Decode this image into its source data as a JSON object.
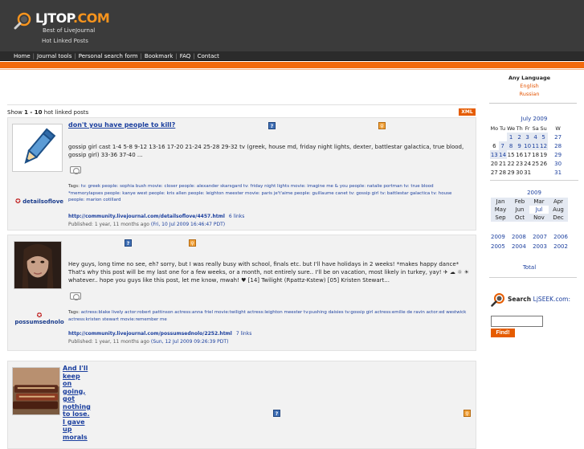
{
  "header": {
    "logo_main": "LJTOP",
    "logo_dot": ".COM",
    "tagline": "Best of LiveJournal",
    "subtitle": "Hot Linked Posts"
  },
  "nav": {
    "items": [
      "Home",
      "Journal tools",
      "Personal search form",
      "Bookmark",
      "FAQ",
      "Contact"
    ]
  },
  "language": {
    "title": "Any Language",
    "options": [
      "English",
      "Russian"
    ]
  },
  "listing": {
    "show_prefix": "Show",
    "range": "1 - 10",
    "suffix": "hot linked posts",
    "xml_label": "XML"
  },
  "posts": [
    {
      "user": "detailsoflove",
      "title": "don't you have people to kill?",
      "text": "gossip girl cast 1-4   5-8 9-12 13-16 17-20 21-24 25-28 29-32 tv (greek, house md, friday night lights, dexter, battlestar galactica, true blood, gossip girl) 33-36 37-40 ...",
      "tags_prefix": "Tags:",
      "tags": "tv: greek people: sophia bush movie: closer people: alexander skarsgard tv: friday night lights movie: imagine me & you people: natalie portman tv: true blood *memorylapses people: kanye west people: kris allen people: leighton meester movie: paris je't'aime people: guillaume canet tv: gossip girl tv: battlestar galactica tv: house people: marion cotillard",
      "link": "http://community.livejournal.com/detailsoflove/4457.html",
      "links_count": "6 links",
      "published_prefix": "Published: 1 year, 11 months ago",
      "published_date": "(Fri, 10 Jul 2009 16:46:47 PDT)"
    },
    {
      "user": "possumsednolo",
      "title": "",
      "text": "Hey guys, long time no see, eh? sorry, but I was really busy with school, finals etc. but I'll have holidays in 2 weeks! *makes happy dance* That's why this post will be my last one for a few weeks, or a month, not entirely sure.. I'll be on vacation, most likely in turkey, yay! ✈ ☁ ☼ ☀ whatever.. hope you guys like this post, let me know, mwah! ♥ [14] Twilight (Rpattz-Kstew) [05] Kristen Stewart...",
      "tags_prefix": "Tags:",
      "tags": "actress:blake lively actor:robert pattinson actress:anna friel movie:twilight actress:leighton meester tv:pushing daisies tv:gossip girl actress:emilie de ravin actor:ed westwick actress:kristen stewart movie:remember me",
      "link": "http://community.livejournal.com/possumsednolo/2252.html",
      "links_count": "7 links",
      "published_prefix": "Published: 1 year, 11 months ago",
      "published_date": "(Sun, 12 Jul 2009 09:26:39 PDT)"
    },
    {
      "user": "",
      "title": "And I'll keep on going, got nothing to lose. I gave up morals"
    }
  ],
  "calendar": {
    "month": "July 2009",
    "headers": [
      "Mo",
      "Tu",
      "We",
      "Th",
      "Fr",
      "Sa",
      "Su",
      "W"
    ],
    "rows": [
      [
        "",
        "",
        "1",
        "2",
        "3",
        "4",
        "5",
        "27"
      ],
      [
        "6",
        "7",
        "8",
        "9",
        "10",
        "11",
        "12",
        "28"
      ],
      [
        "13",
        "14",
        "15",
        "16",
        "17",
        "18",
        "19",
        "29"
      ],
      [
        "20",
        "21",
        "22",
        "23",
        "24",
        "25",
        "26",
        "30"
      ],
      [
        "27",
        "28",
        "29",
        "30",
        "31",
        "",
        "",
        "31"
      ]
    ],
    "year": "2009",
    "months": [
      [
        "Jan",
        "Feb",
        "Mar",
        "Apr"
      ],
      [
        "May",
        "Jun",
        "Jul",
        "Aug"
      ],
      [
        "Sep",
        "Oct",
        "Nov",
        "Dec"
      ]
    ],
    "years": [
      [
        "2009",
        "2008",
        "2007",
        "2006"
      ],
      [
        "2005",
        "2004",
        "2003",
        "2002"
      ]
    ],
    "total": "Total"
  },
  "search": {
    "label": "Search",
    "site": "LjSEEK.com:",
    "button": "Find!",
    "value": ""
  },
  "colors": {
    "accent": "#f26a0d",
    "header_bg": "#3b3b3b",
    "link": "#1b3f9e"
  }
}
